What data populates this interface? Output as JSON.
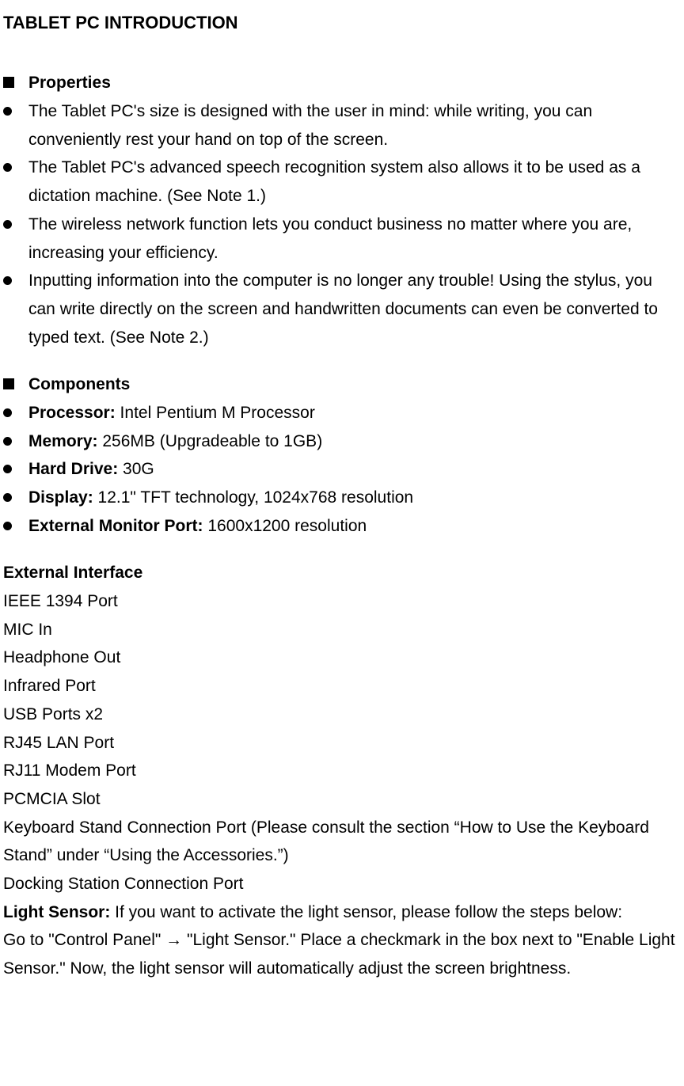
{
  "title": "TABLET PC INTRODUCTION",
  "sections": {
    "properties": {
      "heading": "Properties",
      "items": [
        "The Tablet PC's size is designed with the user in mind: while writing, you can conveniently rest your hand on top of the screen.",
        "The Tablet PC's advanced speech recognition system also allows it to be used as a dictation machine. (See Note 1.)",
        "The wireless network function lets you conduct business no matter where you are, increasing your efficiency.",
        "Inputting information into the computer is no longer any trouble! Using the stylus, you can write directly on the screen and handwritten documents can even be converted to typed text.    (See Note 2.)"
      ]
    },
    "components": {
      "heading": "Components",
      "items": [
        {
          "label": "Processor:",
          "value": " Intel Pentium M Processor"
        },
        {
          "label": "Memory:",
          "value": " 256MB (Upgradeable to 1GB)"
        },
        {
          "label": "Hard Drive:",
          "value": " 30G"
        },
        {
          "label": "Display:",
          "value": " 12.1\" TFT technology, 1024x768 resolution"
        },
        {
          "label": "External Monitor Port:",
          "value": " 1600x1200 resolution"
        }
      ]
    },
    "external_interface": {
      "heading": "External Interface",
      "lines": [
        "IEEE 1394 Port",
        "MIC In",
        "Headphone Out",
        "Infrared Port",
        "USB Ports x2",
        "RJ45 LAN Port",
        "RJ11 Modem Port",
        "PCMCIA Slot",
        "Keyboard Stand Connection Port (Please consult the section “How to Use the Keyboard Stand” under “Using the Accessories.”)",
        "Docking Station Connection Port"
      ],
      "light_sensor": {
        "label": "Light Sensor:",
        "text": " If you want to activate the light sensor, please follow the steps below:"
      },
      "instructions": "Go to \"Control Panel\" → \"Light Sensor.\"    Place a checkmark in the box next to \"Enable Light Sensor.\"    Now, the light sensor will automatically adjust the screen brightness."
    }
  }
}
